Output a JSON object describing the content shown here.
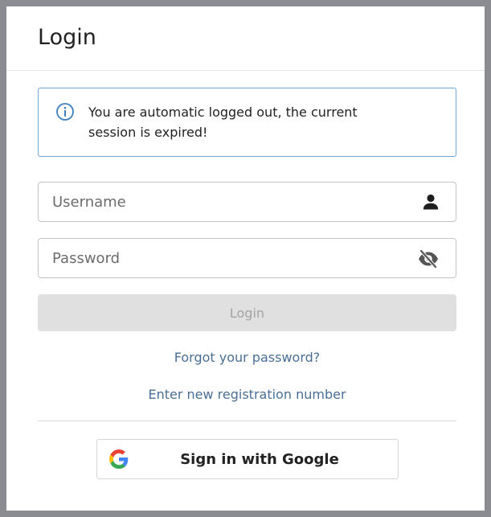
{
  "header": {
    "title": "Login"
  },
  "alert": {
    "icon": "info-circle-icon",
    "message": "You are automatic logged out, the current session is expired!",
    "border_color": "#6fa6d2"
  },
  "username": {
    "placeholder": "Username",
    "value": "",
    "icon": "user-icon"
  },
  "password": {
    "placeholder": "Password",
    "value": "",
    "icon": "eye-slash-icon"
  },
  "login_button": {
    "label": "Login",
    "state": "disabled"
  },
  "links": {
    "forgot_password": "Forgot your password?",
    "new_registration": "Enter new registration number"
  },
  "google": {
    "label": "Sign in with Google",
    "icon": "google-logo-icon"
  },
  "colors": {
    "link": "#4a6f94",
    "disabled_button_bg": "#e0e0e0",
    "disabled_button_text": "#a3a3a3"
  }
}
